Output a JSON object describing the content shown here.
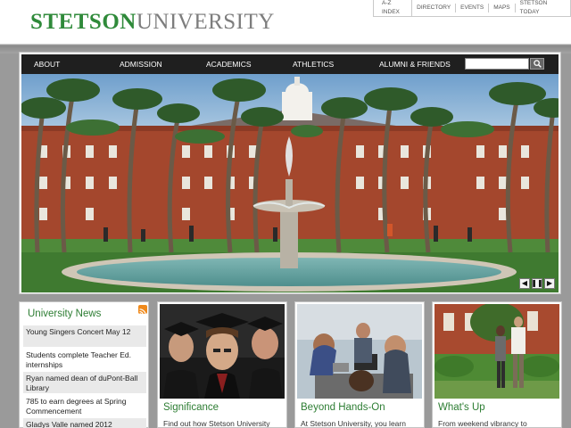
{
  "header": {
    "logo_primary": "STETSON",
    "logo_secondary": "UNIVERSITY",
    "utility_links": [
      "A-Z INDEX",
      "DIRECTORY",
      "EVENTS",
      "MAPS",
      "STETSON TODAY"
    ]
  },
  "nav": {
    "items": [
      "ABOUT",
      "ADMISSION",
      "ACADEMICS",
      "ATHLETICS",
      "ALUMNI & FRIENDS"
    ],
    "search_value": ""
  },
  "slideshow": {
    "prev_glyph": "◀",
    "pause_glyph": "❚❚",
    "next_glyph": "▶"
  },
  "news": {
    "title": "University News",
    "items": [
      "Young Singers Concert May 12",
      "Students complete Teacher Ed. internships",
      "Ryan named dean of duPont-Ball Library",
      "785 to earn degrees at Spring Commencement",
      "Gladys Valle named 2012"
    ]
  },
  "cards": [
    {
      "title": "Significance",
      "text": "Find out how Stetson University"
    },
    {
      "title": "Beyond Hands-On",
      "text": "At Stetson University, you learn"
    },
    {
      "title": "What's Up",
      "text": "From weekend vibrancy to"
    }
  ],
  "colors": {
    "brand_green": "#2f8a3a",
    "nav_bg": "#1f1f1f",
    "brick": "#a0452c"
  }
}
